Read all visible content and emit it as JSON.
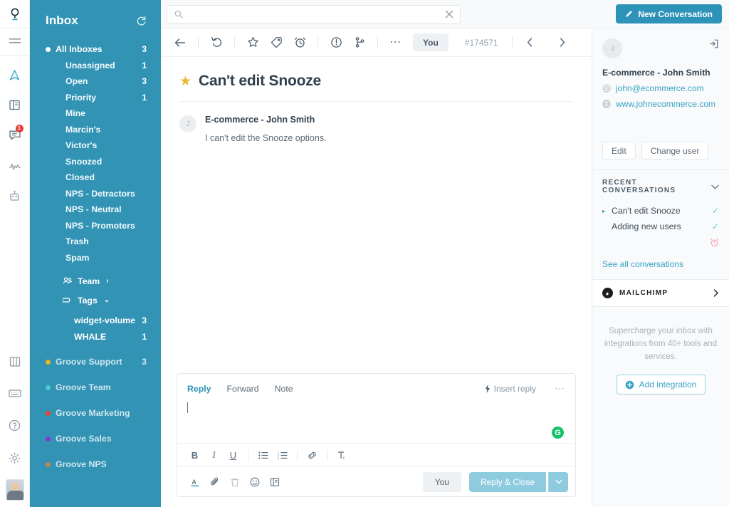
{
  "rail": {
    "items": [
      {
        "name": "groove-logo",
        "label": "Groove"
      },
      {
        "name": "menu-icon",
        "label": "Menu"
      },
      {
        "name": "navigation-icon",
        "label": "Navigation"
      },
      {
        "name": "knowledge-base-icon",
        "label": "Knowledge Base"
      },
      {
        "name": "conversations-icon",
        "label": "Conversations",
        "badge": "1"
      },
      {
        "name": "reports-icon",
        "label": "Reports"
      },
      {
        "name": "automation-icon",
        "label": "Automations"
      },
      {
        "name": "widgets-icon",
        "label": "Widgets"
      },
      {
        "name": "keyboard-icon",
        "label": "Keyboard"
      },
      {
        "name": "help-icon",
        "label": "Help"
      },
      {
        "name": "settings-icon",
        "label": "Settings"
      },
      {
        "name": "user-avatar",
        "label": "Profile"
      }
    ]
  },
  "sidebar": {
    "title": "Inbox",
    "refresh_icon": "refresh-icon",
    "all_inboxes": {
      "label": "All Inboxes",
      "count": "3"
    },
    "folders": [
      {
        "label": "Unassigned",
        "count": "1"
      },
      {
        "label": "Open",
        "count": "3"
      },
      {
        "label": "Priority",
        "count": "1"
      },
      {
        "label": "Mine",
        "count": ""
      },
      {
        "label": "Marcin's",
        "count": ""
      },
      {
        "label": "Victor's",
        "count": ""
      },
      {
        "label": "Snoozed",
        "count": ""
      },
      {
        "label": "Closed",
        "count": ""
      },
      {
        "label": "NPS - Detractors",
        "count": ""
      },
      {
        "label": "NPS - Neutral",
        "count": ""
      },
      {
        "label": "NPS - Promoters",
        "count": ""
      },
      {
        "label": "Trash",
        "count": ""
      },
      {
        "label": "Spam",
        "count": ""
      }
    ],
    "team_group": {
      "label": "Team",
      "chevron": "chevron-right-icon"
    },
    "tags_group": {
      "label": "Tags",
      "chevron": "chevron-down-icon"
    },
    "tags": [
      {
        "label": "widget-volume",
        "count": "3"
      },
      {
        "label": "WHALE",
        "count": "1"
      }
    ],
    "mailboxes": [
      {
        "label": "Groove Support",
        "count": "3",
        "color": "#e8b428"
      },
      {
        "label": "Groove Team",
        "count": "",
        "color": "#4ccbd4"
      },
      {
        "label": "Groove Marketing",
        "count": "",
        "color": "#e8472e"
      },
      {
        "label": "Groove Sales",
        "count": "",
        "color": "#8139d6"
      },
      {
        "label": "Groove NPS",
        "count": "",
        "color": "#c2874a"
      }
    ]
  },
  "topbar": {
    "search": {
      "value": "",
      "placeholder": "",
      "icon": "search-icon",
      "clear_icon": "close-icon"
    },
    "new_conversation": {
      "label": "New Conversation",
      "icon": "pencil-icon",
      "color": "#2e93b8"
    }
  },
  "conversation_toolbar": {
    "back_icon": "arrow-left-icon",
    "buttons": [
      {
        "name": "reopen-icon"
      },
      {
        "name": "star-icon"
      },
      {
        "name": "tag-icon"
      },
      {
        "name": "snooze-icon"
      },
      {
        "name": "priority-icon"
      },
      {
        "name": "merge-icon"
      },
      {
        "name": "more-icon"
      }
    ],
    "assignee_label": "You",
    "ticket_id": "#174571",
    "prev_icon": "chevron-left-icon",
    "next_icon": "chevron-right-icon"
  },
  "conversation": {
    "starred": true,
    "title": "Can't edit Snooze",
    "message": {
      "avatar_initial": "J",
      "author": "E-commerce - John Smith",
      "body": "I can't edit the Snooze options."
    }
  },
  "composer": {
    "tabs": [
      {
        "label": "Reply",
        "active": true
      },
      {
        "label": "Forward",
        "active": false
      },
      {
        "label": "Note",
        "active": false
      }
    ],
    "insert_reply": {
      "label": "Insert reply",
      "icon": "lightning-icon"
    },
    "more_icon": "more-icon",
    "editor_value": "",
    "grammarly_badge": "G",
    "format_buttons": [
      {
        "name": "bold-icon",
        "glyph": "B"
      },
      {
        "name": "italic-icon",
        "glyph": "I"
      },
      {
        "name": "underline-icon",
        "glyph": "U"
      },
      {
        "name": "bulleted-list-icon",
        "glyph": ""
      },
      {
        "name": "numbered-list-icon",
        "glyph": ""
      },
      {
        "name": "link-icon",
        "glyph": ""
      },
      {
        "name": "clear-formatting-icon",
        "glyph": ""
      }
    ],
    "action_icons": [
      {
        "name": "text-color-icon"
      },
      {
        "name": "attachment-icon"
      },
      {
        "name": "trash-icon"
      },
      {
        "name": "emoji-icon"
      },
      {
        "name": "canned-reply-icon"
      }
    ],
    "assignee_label": "You",
    "submit_label": "Reply & Close",
    "submit_caret_icon": "chevron-down-icon",
    "submit_color": "#8ecbdf"
  },
  "right_panel": {
    "avatar_initial": "J",
    "open_icon": "open-in-new-icon",
    "customer_name": "E-commerce - John Smith",
    "email": {
      "value": "john@ecommerce.com",
      "icon": "at-icon"
    },
    "website": {
      "value": "www.johnecommerce.com",
      "icon": "globe-icon"
    },
    "edit_label": "Edit",
    "change_user_label": "Change user",
    "recent_conversations": {
      "title": "RECENT CONVERSATIONS",
      "chevron": "chevron-down-icon",
      "items": [
        {
          "label": "Can't edit Snooze",
          "status_icon": "check-icon",
          "active": true
        },
        {
          "label": "Adding new users",
          "status_icon": "check-icon",
          "active": false
        },
        {
          "label": "",
          "status_icon": "alarm-icon",
          "active": false
        }
      ],
      "see_all_label": "See all conversations"
    },
    "mailchimp": {
      "label": "MAILCHIMP",
      "chevron": "chevron-right-icon"
    },
    "promo_text": "Supercharge your inbox with integrations from 40+ tools and services.",
    "add_integration": {
      "label": "Add integration",
      "icon": "plus-circle-icon"
    }
  }
}
